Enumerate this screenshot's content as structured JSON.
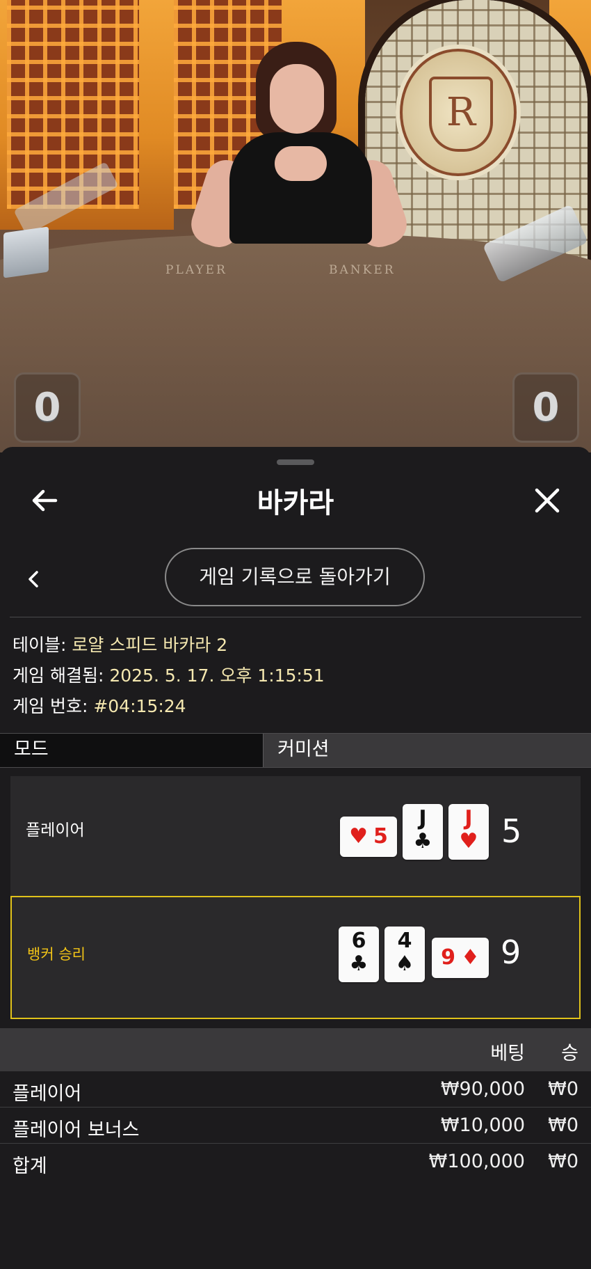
{
  "video": {
    "table_labels": {
      "player": "PLAYER",
      "banker": "BANKER"
    },
    "medallion_letter": "R",
    "score_left": "0",
    "score_right": "0"
  },
  "header": {
    "title": "바카라",
    "back_icon": "arrow-left-icon",
    "close_icon": "close-icon"
  },
  "subnav": {
    "back_icon": "chevron-left-icon",
    "return_label": "게임 기록으로 돌아가기"
  },
  "info": {
    "table_label": "테이블: ",
    "table_value": "로얄 스피드 바카라 2",
    "resolved_label": "게임 해결됨: ",
    "resolved_value": "2025. 5. 17. 오후 1:15:51",
    "game_no_label": "게임 번호: ",
    "game_no_value": "#04:15:24"
  },
  "tabs": {
    "mode": "모드",
    "commission": "커미션"
  },
  "hands": {
    "player": {
      "label": "플레이어",
      "total": "5",
      "cards": [
        {
          "rank": "5",
          "suit": "♥",
          "color": "red",
          "orientation": "horizontal"
        },
        {
          "rank": "J",
          "suit": "♣",
          "color": "black",
          "orientation": "vertical"
        },
        {
          "rank": "J",
          "suit": "♥",
          "color": "red",
          "orientation": "vertical"
        }
      ]
    },
    "banker": {
      "label": "뱅커 승리",
      "label_color": "#f2c417",
      "total": "9",
      "cards": [
        {
          "rank": "6",
          "suit": "♣",
          "color": "black",
          "orientation": "vertical"
        },
        {
          "rank": "4",
          "suit": "♠",
          "color": "black",
          "orientation": "vertical"
        },
        {
          "rank": "9",
          "suit": "♦",
          "color": "red",
          "orientation": "horizontal"
        }
      ]
    }
  },
  "bets": {
    "header": {
      "bet": "베팅",
      "win": "승"
    },
    "rows": [
      {
        "name": "플레이어",
        "bet": "₩90,000",
        "win": "₩0"
      },
      {
        "name": "플레이어 보너스",
        "bet": "₩10,000",
        "win": "₩0"
      }
    ],
    "total": {
      "name": "합계",
      "bet": "₩100,000",
      "win": "₩0"
    }
  },
  "colors": {
    "panel_bg": "#1c1b1d",
    "highlight_border": "#e0c21a",
    "info_value": "#f5e8b0"
  }
}
